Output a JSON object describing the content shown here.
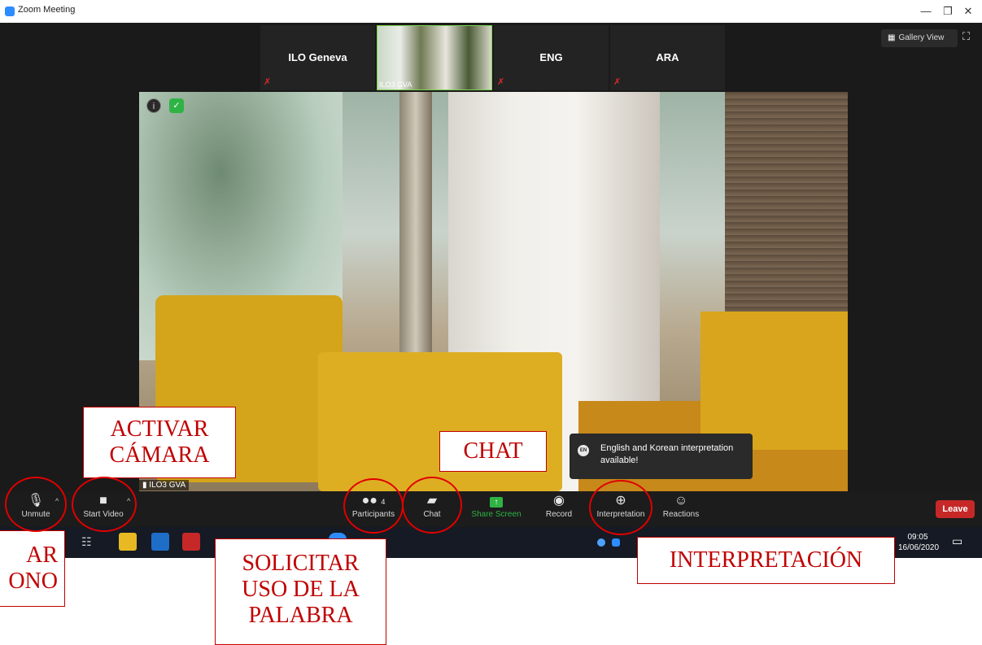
{
  "window": {
    "title": "Zoom Meeting",
    "controls": [
      "—",
      "❐",
      "✕"
    ]
  },
  "top_strip": {
    "tiles": [
      {
        "name": "ILO Geneva",
        "muted": true
      },
      {
        "name": "ILO3 GVA",
        "muted": false
      },
      {
        "name": "ENG",
        "muted": true
      },
      {
        "name": "ARA",
        "muted": true
      }
    ]
  },
  "view": {
    "gallery_label": "Gallery View"
  },
  "main_video": {
    "participant": "ILO3 GVA"
  },
  "notification": {
    "badge": "EN",
    "text": "English and Korean interpretation available!"
  },
  "toolbar": {
    "unmute": "Unmute",
    "start_video": "Start Video",
    "participants": "Participants",
    "participants_count": "4",
    "chat": "Chat",
    "share_screen": "Share Screen",
    "record": "Record",
    "interpretation": "Interpretation",
    "reactions": "Reactions",
    "leave": "Leave"
  },
  "taskbar": {
    "time": "09:05",
    "date": "16/06/2020"
  },
  "annotations": {
    "activar_camara": [
      "ACTIVAR",
      "CÁMARA"
    ],
    "chat": "CHAT",
    "interpretacion": "INTERPRETACIÓN",
    "solicitar": [
      "SOLICITAR",
      "USO DE LA",
      "PALABRA"
    ],
    "microfono_partial": [
      "AR",
      "ONO"
    ]
  },
  "colors": {
    "accent_green": "#7cd44d",
    "leave_red": "#c62828",
    "annotation_red": "#c00000",
    "share_green": "#2fb344"
  }
}
